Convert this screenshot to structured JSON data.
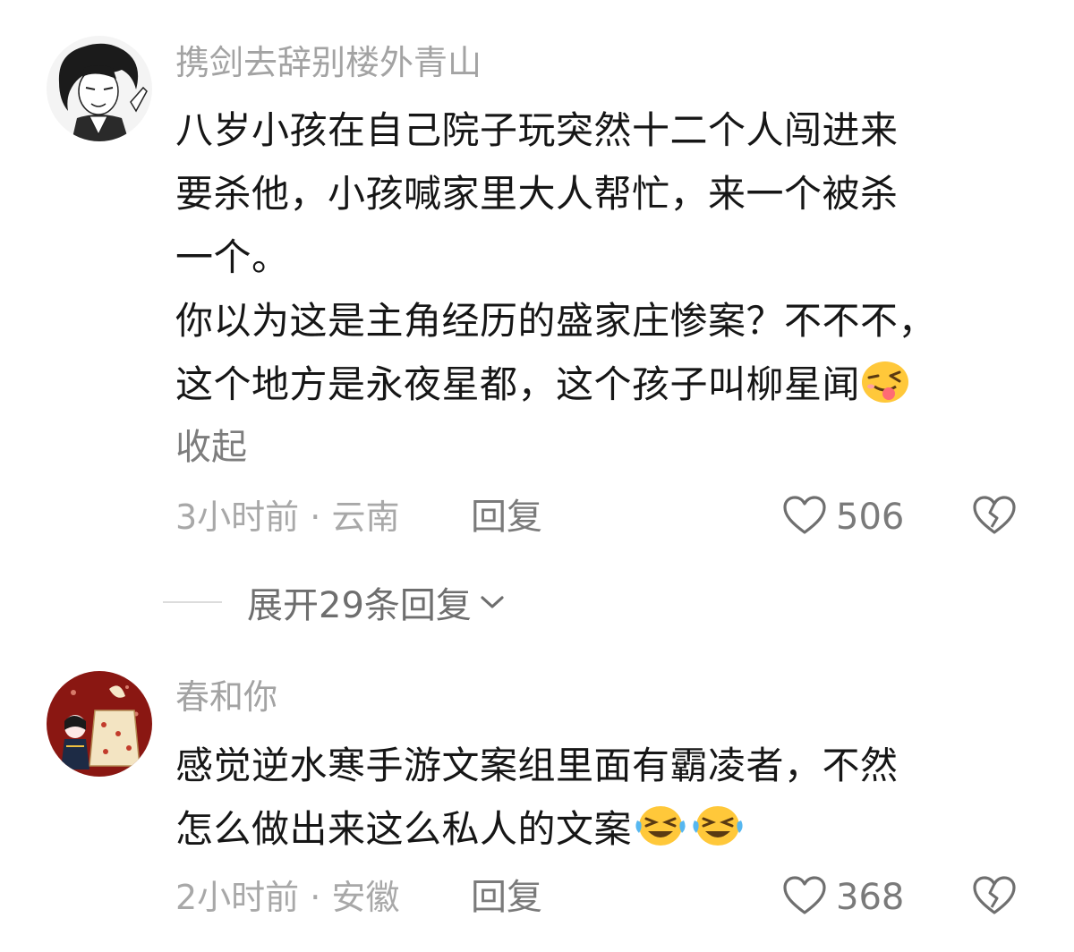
{
  "comments": [
    {
      "username": "携剑去辞别楼外青山",
      "lines": [
        "八岁小孩在自己院子玩突然十二个人闯进来",
        "要杀他，小孩喊家里大人帮忙，来一个被杀",
        "一个。",
        "你以为这是主角经历的盛家庄惨案？不不不，",
        "这个地方是永夜星都，这个孩子叫柳星闻"
      ],
      "trailing_emoji": "winking-tongue-emoji",
      "collapse_label": "收起",
      "time": "3小时前",
      "location": "云南",
      "reply_label": "回复",
      "like_count": "506",
      "expand_replies_label": "展开29条回复"
    },
    {
      "username": "春和你",
      "lines": [
        "感觉逆水寒手游文案组里面有霸凌者，不然",
        "怎么做出来这么私人的文案"
      ],
      "trailing_emoji": "laughing-crying-emoji",
      "time": "2小时前",
      "location": "安徽",
      "reply_label": "回复",
      "like_count": "368"
    }
  ],
  "meta_separator": " · ",
  "icons": {
    "like": "heart-outline-icon",
    "dislike": "broken-heart-outline-icon",
    "expand": "chevron-down-icon"
  },
  "colors": {
    "username": "#a3a3a3",
    "body": "#161616",
    "meta": "#a8a8a8",
    "action": "#7a7a7a",
    "emoji_yellow": "#ffc83a"
  }
}
